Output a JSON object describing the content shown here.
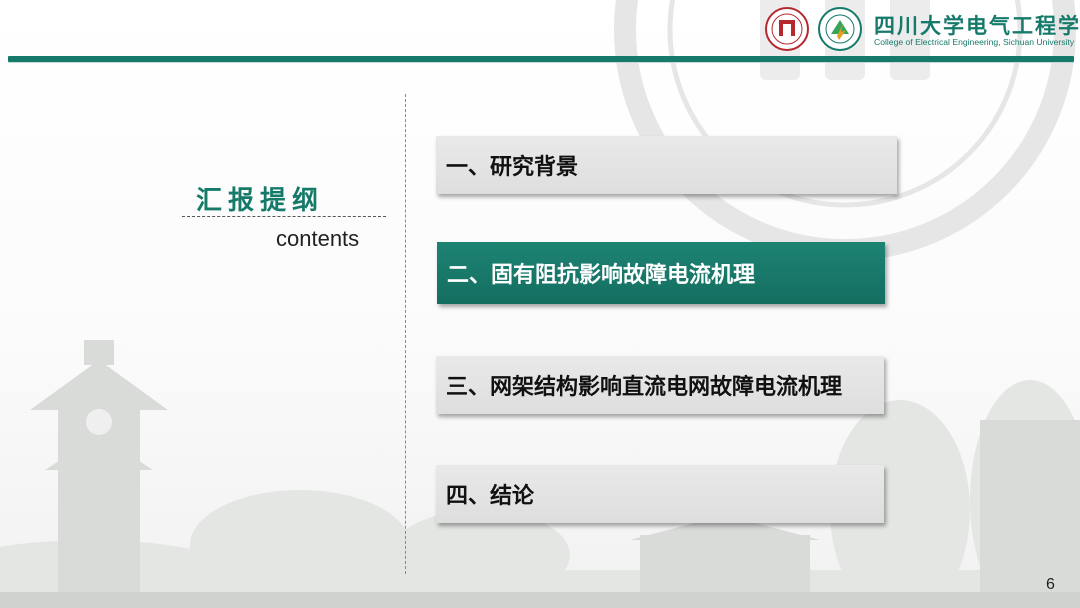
{
  "header": {
    "college_name_cn": "四川大学电气工程学院",
    "college_name_en": "College of Electrical Engineering, Sichuan University"
  },
  "title": {
    "cn": "汇报提纲",
    "en": "contents"
  },
  "menu": {
    "items": [
      {
        "label": "一、研究背景",
        "active": false
      },
      {
        "label": "二、固有阻抗影响故障电流机理",
        "active": true
      },
      {
        "label": "三、网架结构影响直流电网故障电流机理",
        "active": false
      },
      {
        "label": "四、结论",
        "active": false
      }
    ]
  },
  "page_number": "6",
  "colors": {
    "accent": "#167a6a",
    "logo_red": "#b5282d",
    "menu_bg": "#e3e3e3"
  }
}
